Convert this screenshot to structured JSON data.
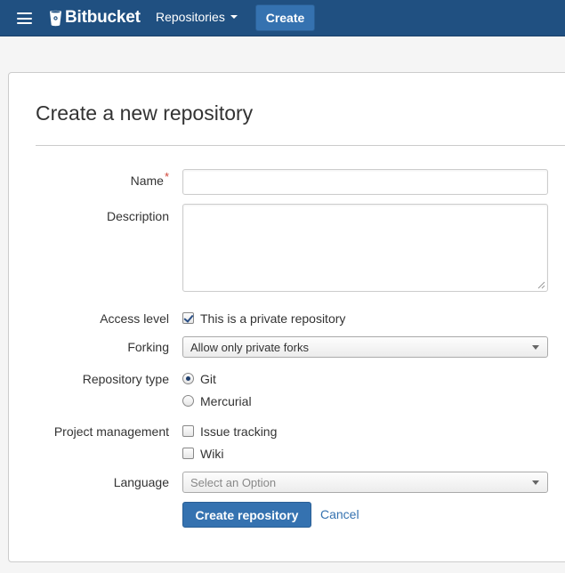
{
  "header": {
    "logo_text": "Bitbucket",
    "repositories_label": "Repositories",
    "create_label": "Create",
    "colors": {
      "bar": "#205081",
      "button": "#3572b0"
    }
  },
  "form": {
    "title": "Create a new repository",
    "name": {
      "label": "Name",
      "required_mark": "*",
      "value": ""
    },
    "description": {
      "label": "Description",
      "value": ""
    },
    "access_level": {
      "label": "Access level",
      "checkbox_label": "This is a private repository",
      "checked": true
    },
    "forking": {
      "label": "Forking",
      "selected": "Allow only private forks"
    },
    "repository_type": {
      "label": "Repository type",
      "options": [
        {
          "label": "Git",
          "selected": true
        },
        {
          "label": "Mercurial",
          "selected": false
        }
      ]
    },
    "project_management": {
      "label": "Project management",
      "options": [
        {
          "label": "Issue tracking",
          "checked": false
        },
        {
          "label": "Wiki",
          "checked": false
        }
      ]
    },
    "language": {
      "label": "Language",
      "placeholder": "Select an Option"
    },
    "submit_label": "Create repository",
    "cancel_label": "Cancel"
  }
}
